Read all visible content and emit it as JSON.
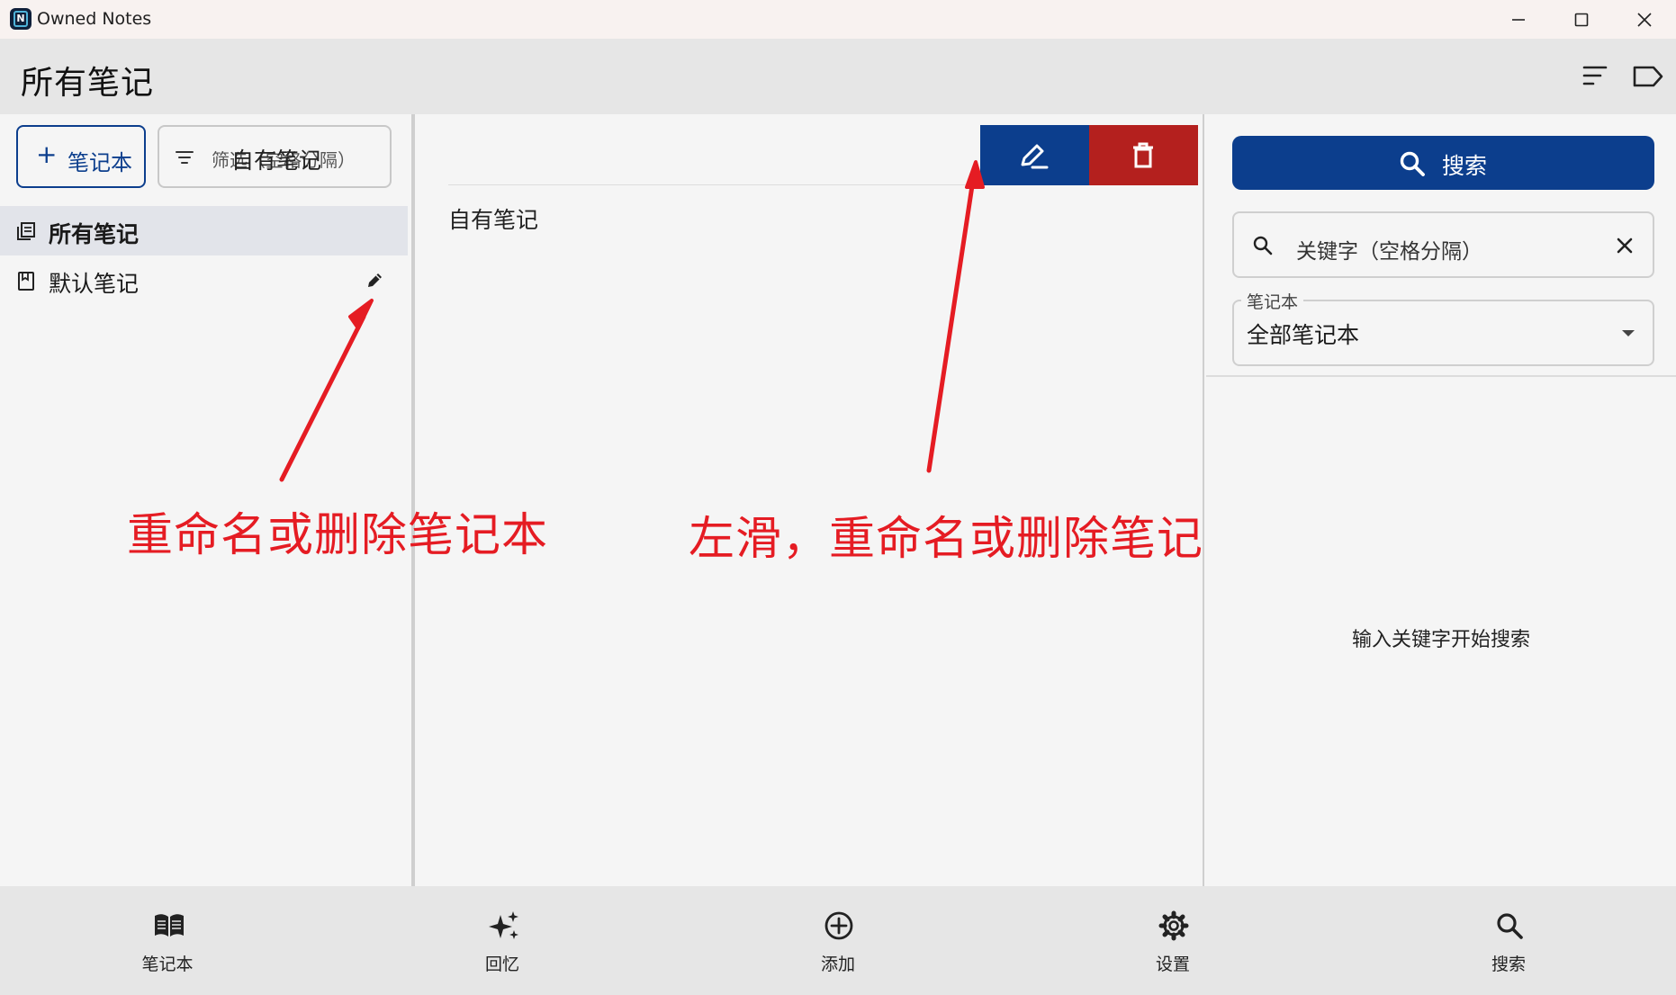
{
  "window": {
    "title": "Owned Notes",
    "app_icon_letter": "N",
    "controls": [
      "minimize",
      "maximize",
      "close"
    ]
  },
  "header": {
    "title": "所有笔记",
    "actions": [
      "sort-icon",
      "label-icon"
    ]
  },
  "notebooks_pane": {
    "add_button_label": "笔记本",
    "filter": {
      "placeholder": "筛选（空格分隔）",
      "overlay_text": "自有笔记"
    },
    "items": [
      {
        "label": "所有笔记",
        "selected": true,
        "icon": "all-notes-icon"
      },
      {
        "label": "默认笔记",
        "selected": false,
        "icon": "notebook-icon",
        "action_icon": "edit-icon"
      }
    ]
  },
  "notes_pane": {
    "swipe_actions": [
      {
        "name": "rename",
        "icon": "edit-icon",
        "color": "#0c3e8d"
      },
      {
        "name": "delete",
        "icon": "trash-icon",
        "color": "#b4201e"
      }
    ],
    "notes": [
      {
        "title": "自有笔记"
      }
    ]
  },
  "search_pane": {
    "search_button_label": "搜索",
    "keyword_placeholder": "关键字（空格分隔）",
    "notebook_select": {
      "label": "笔记本",
      "value": "全部笔记本"
    },
    "empty_hint": "输入关键字开始搜索"
  },
  "bottom_nav": [
    {
      "label": "笔记本",
      "icon": "book-icon"
    },
    {
      "label": "回忆",
      "icon": "sparkle-icon"
    },
    {
      "label": "添加",
      "icon": "add-circle-icon"
    },
    {
      "label": "设置",
      "icon": "gear-icon"
    },
    {
      "label": "搜索",
      "icon": "search-icon"
    }
  ],
  "annotations": {
    "left": "重命名或删除笔记本",
    "right": "左滑，重命名或删除笔记",
    "color": "#e51c23"
  },
  "colors": {
    "accent": "#0c3e8d",
    "danger": "#b4201e"
  }
}
